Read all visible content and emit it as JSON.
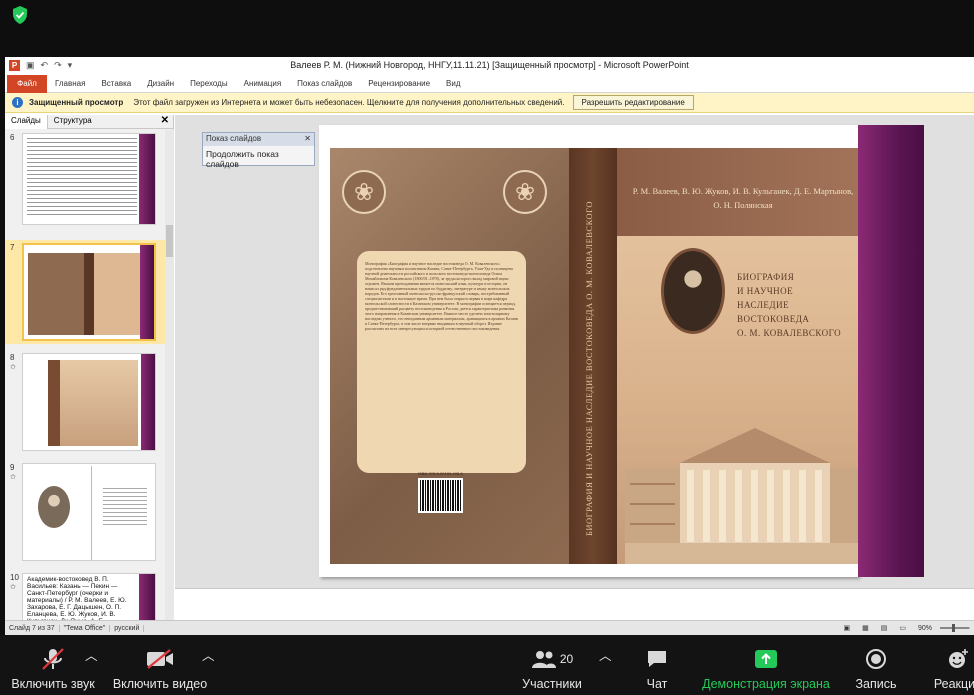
{
  "window": {
    "title": "Валеев Р. М. (Нижний Новгород, ННГУ,11.11.21) [Защищенный просмотр]  -  Microsoft PowerPoint"
  },
  "ribbon": {
    "file": "Файл",
    "tabs": [
      "Главная",
      "Вставка",
      "Дизайн",
      "Переходы",
      "Анимация",
      "Показ слайдов",
      "Рецензирование",
      "Вид"
    ]
  },
  "infobar": {
    "title": "Защищенный просмотр",
    "message": "Этот файл загружен из Интернета и может быть небезопасен. Щелкните для получения дополнительных сведений.",
    "button": "Разрешить редактирование"
  },
  "left_pane": {
    "tab_slides": "Слайды",
    "tab_outline": "Структура",
    "close": "✕",
    "thumbnails": [
      {
        "num": "6"
      },
      {
        "num": "7"
      },
      {
        "num": "8"
      },
      {
        "num": "9"
      },
      {
        "num": "10",
        "caption": "Академик-востоковед В. П. Васильев: Казань — Пекин — Санкт-Петербург (очерки и материалы) / Р. М. Валеев, Е. Ю. Захарова, Е. Г. Дацышен, О. П. Еланцева, Е. Ю. Жуков, И. В. Кульганек, Ли Янью, А. Е. Мартынов"
      }
    ]
  },
  "slideshow_panel": {
    "header": "Показ слайдов",
    "link": "Продолжить показ слайдов",
    "close": "✕"
  },
  "slide": {
    "authors": "Р. М. Валеев, В. Ю. Жуков, И. В. Кульганек, Д. Е. Мартынов, О. Н. Полянская",
    "title_lines": [
      "БИОГРАФИЯ",
      "И НАУЧНОЕ",
      "НАСЛЕДИЕ",
      "ВОСТОКОВЕДА",
      "О. М. КОВАЛЕВСКОГО"
    ],
    "spine_title": "БИОГРАФИЯ И НАУЧНОЕ НАСЛЕДИЕ ВОСТОКОВЕДА О. М. КОВАЛЕВСКОГО",
    "back_text": "Монография «Биография и научное наследие востоковеда О. М. Ковалевского» подготовлена научным коллективом Казани, Санкт-Петербурга, Улан-Удэ и посвящена научной деятельности российского и польского востоковеда-монголоведа Осипа Михайловича Ковалевского (1800/01–1878), за труды которого вклад мировой науки огромен. Языком преподавания является монгольский язык, культура и история, он написал ряд фундаментальных трудов по буддизму, литературе и языку монгольских народов. Его трехтомный монгольско-русско-французский словарь, востребованный специалистами и в настоящее время. При нем была открыта первая в мире кафедра монгольской словесности в Казанском университете. В монографии освещается период, предшествовавший расцвету востоковедения в России, дается характеристика развития этого направления в Казанском университете. Важное место уделено эпистолярному наследию ученого, его неизданным архивным материалам, хранящимся в архивах Казани и Санкт-Петербурга, в том числе впервые вводимым в научный оборот. Издание рассчитано на всех интересующихся историей отечественного востоковедения.",
    "isbn": "ISBN 978-5-00130-493-6"
  },
  "statusbar": {
    "slide": "Слайд 7 из 37",
    "theme": "\"Тема Office\"",
    "lang": "русский",
    "zoom": "90%"
  },
  "zoom_bar": {
    "mute": "Включить звук",
    "video": "Включить видео",
    "participants": "Участники",
    "participants_count": "20",
    "chat": "Чат",
    "share": "Демонстрация экрана",
    "record": "Запись",
    "reactions": "Реакции"
  },
  "colors": {
    "zoom_green": "#24c95a",
    "ppt_orange": "#d24625",
    "infobar": "#fff4c6",
    "selected_thumb": "#f3c24b"
  }
}
